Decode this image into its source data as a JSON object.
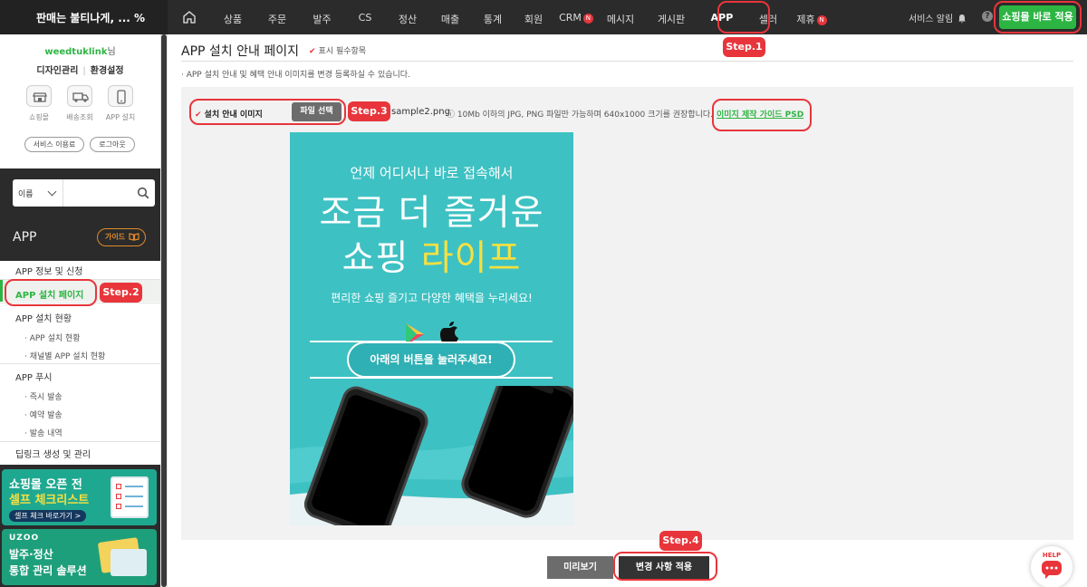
{
  "topbar": {
    "shop_name": "판매는 불티나게, ... %",
    "nav": [
      {
        "label": "상품",
        "badge": ""
      },
      {
        "label": "주문",
        "badge": ""
      },
      {
        "label": "발주",
        "badge": ""
      },
      {
        "label": "CS",
        "badge": ""
      },
      {
        "label": "정산",
        "badge": ""
      },
      {
        "label": "매출",
        "badge": ""
      },
      {
        "label": "통계",
        "badge": ""
      },
      {
        "label": "회원",
        "badge": ""
      },
      {
        "label": "CRM",
        "badge": "N"
      },
      {
        "label": "메시지",
        "badge": ""
      },
      {
        "label": "게시판",
        "badge": ""
      },
      {
        "label": "APP",
        "badge": ""
      },
      {
        "label": "셀러",
        "badge": ""
      },
      {
        "label": "제휴",
        "badge": "N"
      }
    ],
    "service_alarm": "서비스 알림",
    "help": "?",
    "apply_shop_label": "쇼핑몰 바로 적용"
  },
  "steps": {
    "s1": "Step.1",
    "s2": "Step.2",
    "s3": "Step.3",
    "s4": "Step.4"
  },
  "sidebar": {
    "user_id": "weedtuklink",
    "user_suffix": "님",
    "design": "디자인관리",
    "settings": "환경설정",
    "quick": [
      {
        "label": "쇼핑몰",
        "icon": "store-icon"
      },
      {
        "label": "배송조회",
        "icon": "truck-icon"
      },
      {
        "label": "APP 설치",
        "icon": "phone-icon"
      }
    ],
    "service_fee": "서비스 이용료",
    "logout": "로그아웃",
    "search_select": "이름",
    "search_placeholder": "",
    "menu_title": "APP",
    "guide_label": "가이드",
    "menu": {
      "app_info": "APP 정보 및 신청",
      "app_install_page": "APP 설치 페이지",
      "app_install_status": "APP 설치 현황",
      "sub_app_install": "· APP 설치 현황",
      "sub_channel_install": "· 채널별 APP 설치 현황",
      "app_push": "APP 푸시",
      "sub_instant": "· 즉시 발송",
      "sub_reserve": "· 예약 발송",
      "sub_history": "· 발송 내역",
      "deeplink": "딥링크 생성 및 관리"
    },
    "banner1": {
      "line1": "쇼핑몰 오픈 전",
      "line2": "셀프 체크리스트",
      "cta": "셀프 체크 바로가기 >"
    },
    "banner2": {
      "logo": "UZOO",
      "line1": "발주·정산",
      "line2": "통합 관리 솔루션"
    }
  },
  "main": {
    "title": "APP 설치 안내 페이지",
    "required": "표시 필수항목",
    "check_mark": "✔",
    "description": "· APP 설치 안내 및 혜택 안내 이미지를 변경 등록하실 수 있습니다.",
    "field_label": "설치 안내 이미지",
    "file_button": "파일 선택",
    "file_name": "sample2.png",
    "file_hint": "ⓘ 10Mb 이하의 JPG, PNG 파일만 가능하며 640x1000 크기를 권장합니다.",
    "guide_link": "이미지 제작 가이드 PSD",
    "preview_image": {
      "line1": "언제 어디서나 바로 접속해서",
      "line2": "조금 더 즐거운",
      "line3a": "쇼핑 ",
      "line3b": "라이프",
      "line4": "편리한 쇼핑 즐기고 다양한 혜택을 누리세요!",
      "button": "아래의 버튼을 눌러주세요!"
    },
    "preview_button": "미리보기",
    "apply_button": "변경 사항 적용"
  },
  "help_bubble": "HELP",
  "colors": {
    "accent_green": "#2db543",
    "step_red": "#e8353b",
    "topbar": "#2b2b2b",
    "preview_bg": "#3ec1c3",
    "highlight_yellow": "#f7e040"
  }
}
